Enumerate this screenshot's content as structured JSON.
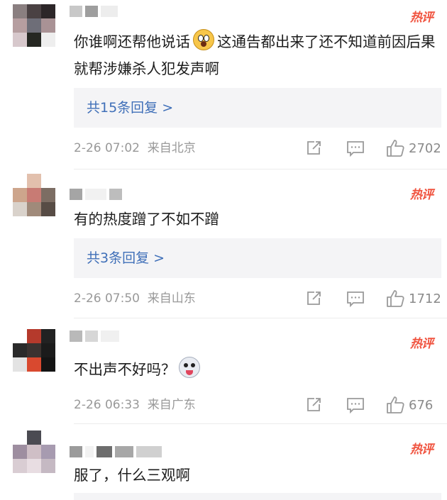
{
  "comments": [
    {
      "text_parts": [
        "你谁啊还帮他说话",
        "这通告都出来了还不知道前因后果就帮涉嫌杀人犯发声啊"
      ],
      "emoji": "shocked-face",
      "badge": "热评",
      "reply_label": "共15条回复 >",
      "timestamp": "2-26 07:02",
      "location": "来自北京",
      "like_count": "2702"
    },
    {
      "text_parts": [
        "有的热度蹭了不如不蹭"
      ],
      "badge": "热评",
      "reply_label": "共3条回复 >",
      "timestamp": "2-26 07:50",
      "location": "来自山东",
      "like_count": "1712"
    },
    {
      "text_parts": [
        "不出声不好吗？"
      ],
      "emoji": "husky-dog-face",
      "badge": "热评",
      "timestamp": "2-26 06:33",
      "location": "来自广东",
      "like_count": "676"
    },
    {
      "text_parts": [
        "服了，什么三观啊"
      ],
      "badge": "热评"
    }
  ],
  "icons": {
    "share": "share-icon",
    "comment": "comment-icon",
    "like": "thumbs-up-icon"
  },
  "colors": {
    "badge": "#f0533f",
    "reply_link": "#3f6fb8",
    "reply_bg": "#f4f4f6",
    "meta_text": "#999999"
  }
}
